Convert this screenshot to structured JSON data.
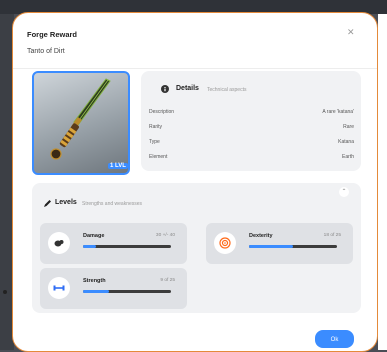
{
  "modal": {
    "title": "Forge Reward",
    "subtitle": "Tanto of Dirt",
    "close_icon": "close-icon",
    "ok_label": "Ok"
  },
  "item": {
    "level_badge": "1 LVL"
  },
  "details": {
    "title": "Details",
    "subtitle": "Technical aspects",
    "rows": [
      {
        "label": "Description",
        "value": "A rare 'katana'"
      },
      {
        "label": "Rarity",
        "value": "Rare"
      },
      {
        "label": "Type",
        "value": "Katana"
      },
      {
        "label": "Element",
        "value": "Earth"
      }
    ]
  },
  "levels": {
    "title": "Levels",
    "subtitle": "Strengths and weaknesses",
    "stats": [
      {
        "name": "Damage",
        "value": "30 +/- 40",
        "progress": 0.15,
        "icon": "damage-icon"
      },
      {
        "name": "Dexterity",
        "value": "18 of 25",
        "progress": 0.5,
        "icon": "target-icon"
      },
      {
        "name": "Strength",
        "value": "9 of 25",
        "progress": 0.3,
        "icon": "dumbbell-icon"
      }
    ]
  },
  "colors": {
    "accent": "#3b8cff",
    "modal_border": "#e48a3a",
    "dexterity_icon": "#ff6a1a",
    "strength_icon": "#2f6df5"
  }
}
